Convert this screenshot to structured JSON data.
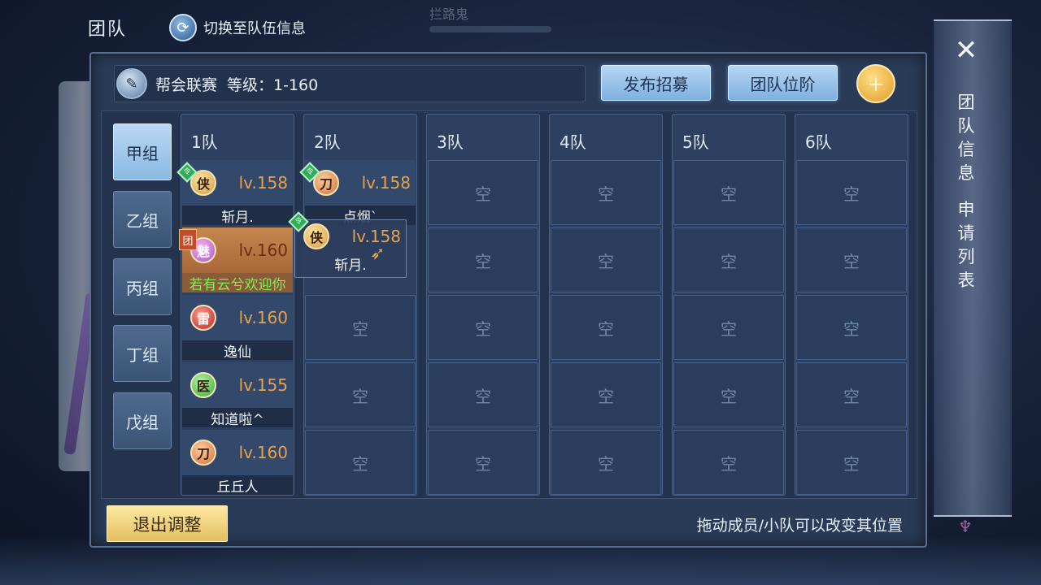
{
  "top": {
    "title": "团队",
    "switch_label": "切换至队伍信息",
    "faint_name": "拦路鬼"
  },
  "header": {
    "league_name": "帮会联赛",
    "level_label": "等级：1-160",
    "recruit_button": "发布招募",
    "rank_button": "团队位阶"
  },
  "groups": [
    "甲组",
    "乙组",
    "丙组",
    "丁组",
    "戊组"
  ],
  "active_group": 0,
  "teams": [
    "1队",
    "2队",
    "3队",
    "4队",
    "5队",
    "6队"
  ],
  "empty_label": "空",
  "team1_members": [
    {
      "name": "斩月.",
      "level": "lv.158",
      "class_glyph": "侠"
    },
    {
      "name": "若有云兮欢迎你",
      "level": "lv.160",
      "class_glyph": "魅",
      "leader_badge": "团"
    },
    {
      "name": "逸仙",
      "level": "lv.160",
      "class_glyph": "雷"
    },
    {
      "name": "知道啦^",
      "level": "lv.155",
      "class_glyph": "医"
    },
    {
      "name": "丘丘人",
      "level": "lv.160",
      "class_glyph": "刀"
    }
  ],
  "team2_members": [
    {
      "name": "点烟`",
      "level": "lv.158",
      "class_glyph": "刀"
    }
  ],
  "dragging_member": {
    "name": "斩月.",
    "level": "lv.158",
    "class_glyph": "侠"
  },
  "footer": {
    "exit_button": "退出调整",
    "hint": "拖动成员/小队可以改变其位置"
  },
  "sidebar": {
    "close_glyph": "✕",
    "team_info": "团队信息",
    "apply_list": "申请列表"
  },
  "colors": {
    "level_orange": "#e9a24a",
    "highlight_name": "#7cf05a",
    "active_tab": "#b9d8f4",
    "exit_button": "#f5d97e"
  }
}
